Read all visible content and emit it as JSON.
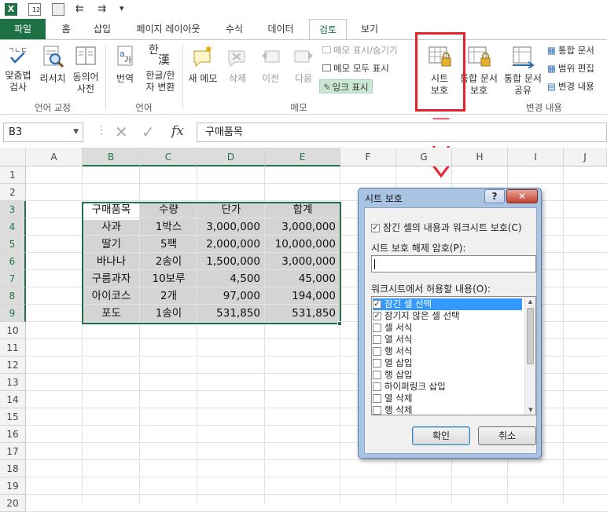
{
  "namebox": "B3",
  "formula": "구매품목",
  "tabs": [
    "파일",
    "홈",
    "삽입",
    "페이지 레이아웃",
    "수식",
    "데이터",
    "검토",
    "보기"
  ],
  "ribbon": {
    "spell": [
      "맞춤법",
      "검사"
    ],
    "research": "리서치",
    "thesaurus": [
      "동의어",
      "사전"
    ],
    "translate": "번역",
    "hanja": [
      "한글/한",
      "자 변환"
    ],
    "han_top": "한",
    "han_bottom": "漢",
    "new_memo": "새 메모",
    "delete": "삭제",
    "prev": "이전",
    "next": "다음",
    "show_hide_memo": "메모 표시/숨기기",
    "show_all_memo": "메모 모두 표시",
    "ink": "잉크 표시",
    "protect_sheet": [
      "시트",
      "보호"
    ],
    "protect_book": [
      "통합 문서",
      "보호"
    ],
    "share_book": [
      "통합 문서",
      "공유"
    ],
    "right1": "통합 문서",
    "right2": "범위 편집",
    "right3": "변경 내용",
    "grp_lang_proof": "언어 교정",
    "grp_lang": "언어",
    "grp_memo": "메모",
    "grp_changes": "변경 내용"
  },
  "fx": "fx",
  "columns": [
    "A",
    "B",
    "C",
    "D",
    "E",
    "F",
    "G",
    "H",
    "I",
    "J"
  ],
  "rows": [
    "1",
    "2",
    "3",
    "4",
    "5",
    "6",
    "7",
    "8",
    "9",
    "10",
    "11",
    "12",
    "13",
    "14",
    "15",
    "16",
    "17",
    "18",
    "19",
    "20"
  ],
  "table": {
    "headers": [
      "구매품목",
      "수량",
      "단가",
      "합계"
    ],
    "rows": [
      [
        "사과",
        "1박스",
        "3,000,000",
        "3,000,000"
      ],
      [
        "딸기",
        "5팩",
        "2,000,000",
        "10,000,000"
      ],
      [
        "바나나",
        "2송이",
        "1,500,000",
        "3,000,000"
      ],
      [
        "구름과자",
        "10보루",
        "4,500",
        "45,000"
      ],
      [
        "아이코스",
        "2개",
        "97,000",
        "194,000"
      ],
      [
        "포도",
        "1송이",
        "531,850",
        "531,850"
      ]
    ]
  },
  "dialog": {
    "title": "시트 보호",
    "help": "?",
    "protect_check": "잠긴 셀의 내용과 워크시트 보호(C)",
    "password_label": "시트 보호 해제 암호(P):",
    "allow_label": "워크시트에서 허용할 내용(O):",
    "options": [
      {
        "label": "잠긴 셀 선택",
        "checked": true
      },
      {
        "label": "잠기지 않은 셀 선택",
        "checked": true
      },
      {
        "label": "셀 서식",
        "checked": false
      },
      {
        "label": "열 서식",
        "checked": false
      },
      {
        "label": "행 서식",
        "checked": false
      },
      {
        "label": "열 삽입",
        "checked": false
      },
      {
        "label": "행 삽입",
        "checked": false
      },
      {
        "label": "하이퍼링크 삽입",
        "checked": false
      },
      {
        "label": "열 삭제",
        "checked": false
      },
      {
        "label": "행 삭제",
        "checked": false
      }
    ],
    "ok": "확인",
    "cancel": "취소"
  },
  "qat_badge": "12"
}
